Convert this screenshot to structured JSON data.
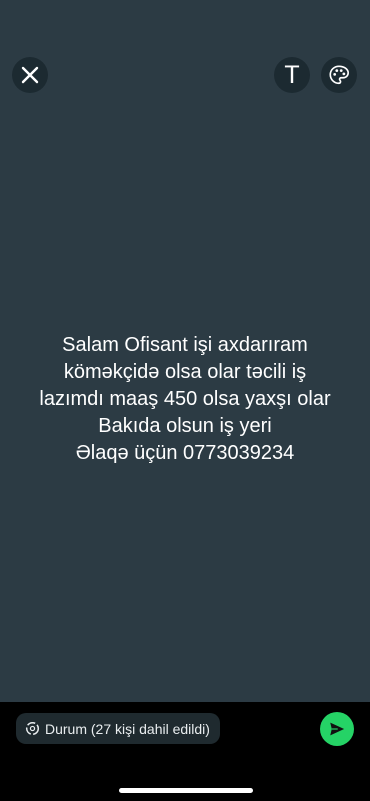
{
  "toolbar": {
    "close_icon": "close-icon",
    "text_label": "T",
    "palette_icon": "palette-icon"
  },
  "status": {
    "background_color": "#2c3b44",
    "lines": [
      "Salam Ofisant işi axdarıram",
      "köməkçidə olsa olar təcili iş",
      "lazımdı maaş 450 olsa yaxşı olar",
      "Bakıda olsun iş yeri",
      "Əlaqə üçün 0773039234"
    ]
  },
  "footer": {
    "audience_label": "Durum (27 kişi dahil edildi)",
    "send_icon": "send-icon",
    "send_color": "#25d366"
  }
}
